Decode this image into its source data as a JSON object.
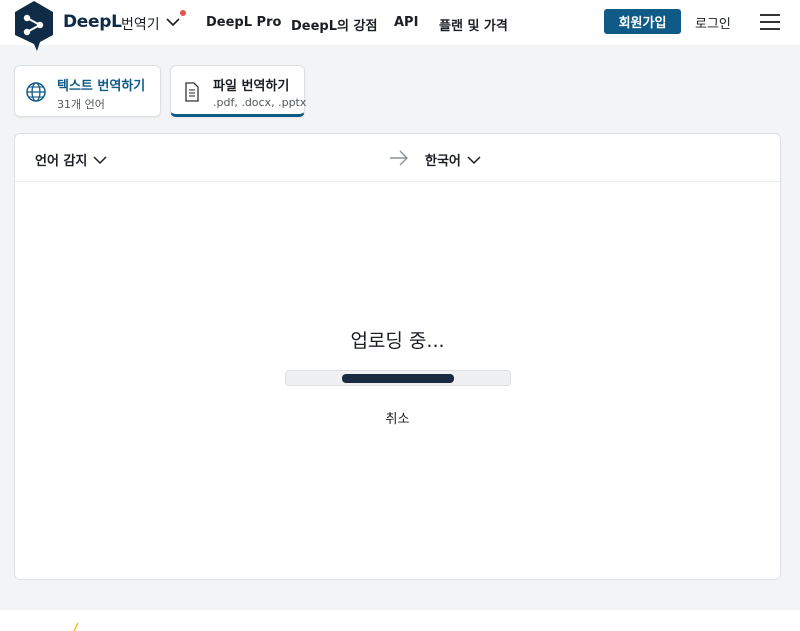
{
  "header": {
    "brand": "DeepL",
    "brand_sub": "번역기",
    "nav": [
      "DeepL Pro",
      "DeepL의 강점",
      "API",
      "플랜 및 가격"
    ],
    "signup_label": "회원가입",
    "login_label": "로그인"
  },
  "tabs": [
    {
      "title": "텍스트 번역하기",
      "subtitle": "31개 언어",
      "icon": "globe-icon"
    },
    {
      "title": "파일 번역하기",
      "subtitle": ".pdf, .docx, .pptx",
      "icon": "document-icon"
    }
  ],
  "languages": {
    "source": "언어 감지",
    "target": "한국어"
  },
  "upload": {
    "status": "업로딩 중...",
    "progress": 0.5,
    "cancel_label": "취소"
  },
  "colors": {
    "brand": "#0f2b46",
    "accent": "#0f5a86",
    "notification": "#e2544d",
    "progress": "#1a2b41"
  }
}
